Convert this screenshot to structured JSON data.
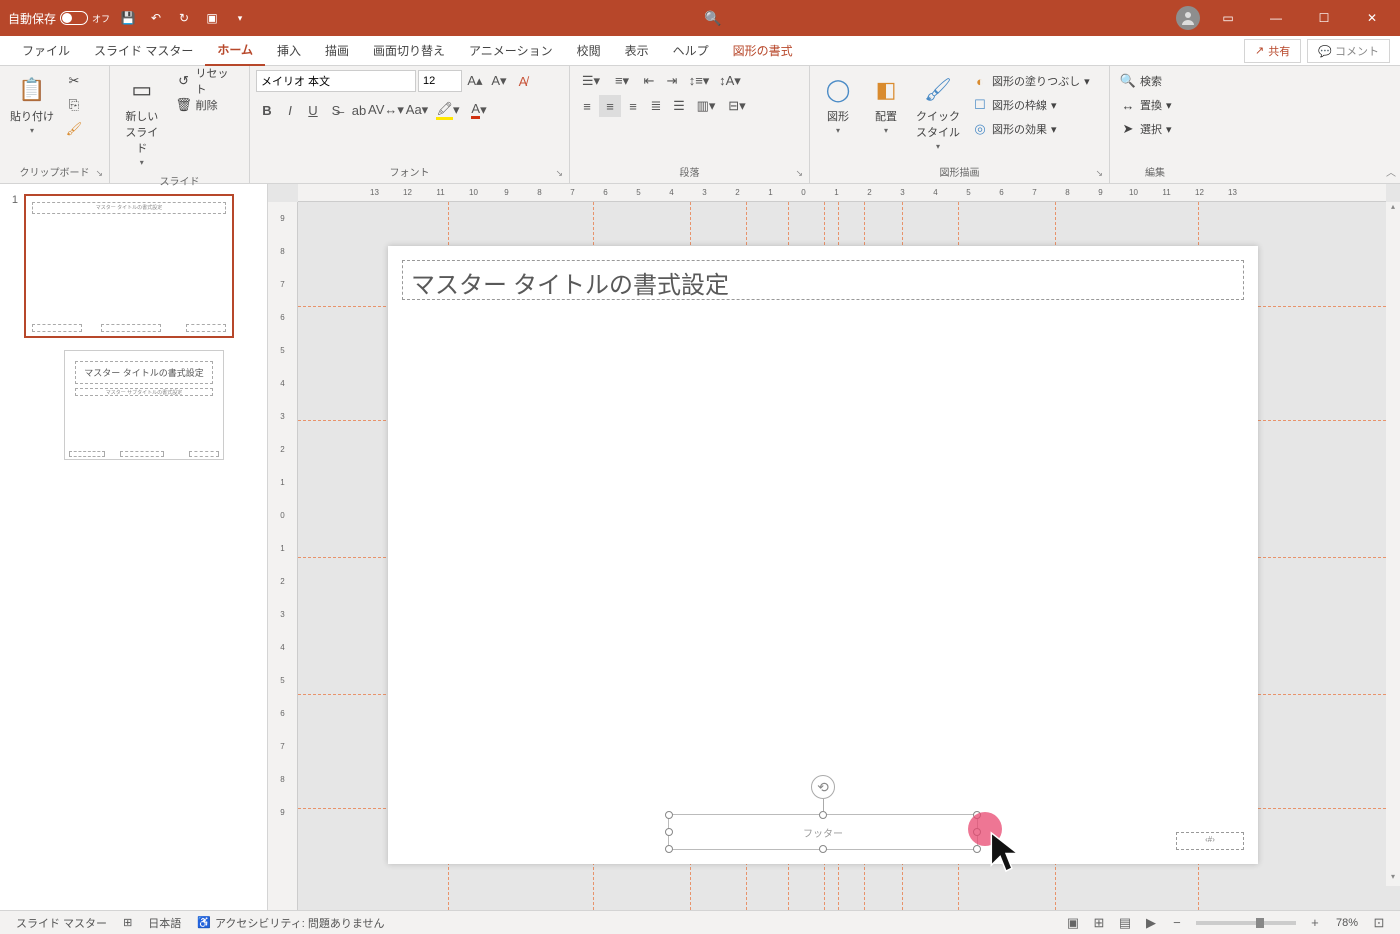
{
  "titlebar": {
    "autosave_label": "自動保存",
    "autosave_state": "オフ"
  },
  "tabs": {
    "file": "ファイル",
    "slide_master": "スライド マスター",
    "home": "ホーム",
    "insert": "挿入",
    "draw": "描画",
    "transitions": "画面切り替え",
    "animations": "アニメーション",
    "review": "校閲",
    "view": "表示",
    "help": "ヘルプ",
    "shape_format": "図形の書式",
    "share": "共有",
    "comment": "コメント"
  },
  "ribbon": {
    "clipboard": {
      "paste": "貼り付け",
      "label": "クリップボード"
    },
    "slides": {
      "new_slide": "新しい\nスライド",
      "reset": "リセット",
      "delete": "削除",
      "label": "スライド"
    },
    "font": {
      "name": "メイリオ 本文",
      "size": "12",
      "label": "フォント"
    },
    "paragraph": {
      "label": "段落"
    },
    "drawing": {
      "shapes": "図形",
      "arrange": "配置",
      "quick_styles": "クイック\nスタイル",
      "fill": "図形の塗りつぶし",
      "outline": "図形の枠線",
      "effects": "図形の効果",
      "label": "図形描画"
    },
    "editing": {
      "find": "検索",
      "replace": "置換",
      "select": "選択",
      "label": "編集"
    }
  },
  "ruler": {
    "h": [
      "13",
      "12",
      "11",
      "10",
      "9",
      "8",
      "7",
      "6",
      "5",
      "4",
      "3",
      "2",
      "1",
      "0",
      "1",
      "2",
      "3",
      "4",
      "5",
      "6",
      "7",
      "8",
      "9",
      "10",
      "11",
      "12",
      "13"
    ],
    "v": [
      "9",
      "8",
      "7",
      "6",
      "5",
      "4",
      "3",
      "2",
      "1",
      "0",
      "1",
      "2",
      "3",
      "4",
      "5",
      "6",
      "7",
      "8",
      "9"
    ]
  },
  "slide": {
    "number": "1",
    "master_title": "マスター タイトルの書式設定",
    "footer_text": "フッター",
    "pagenum_text": "‹#›",
    "thumb_title": "マスター タイトルの書式設定"
  },
  "layout_thumb": {
    "title": "マスター タイトルの書式設定",
    "subtitle": "マスター サブタイトルの書式設定"
  },
  "statusbar": {
    "mode": "スライド マスター",
    "language": "日本語",
    "accessibility": "アクセシビリティ: 問題ありません",
    "zoom": "78%"
  }
}
